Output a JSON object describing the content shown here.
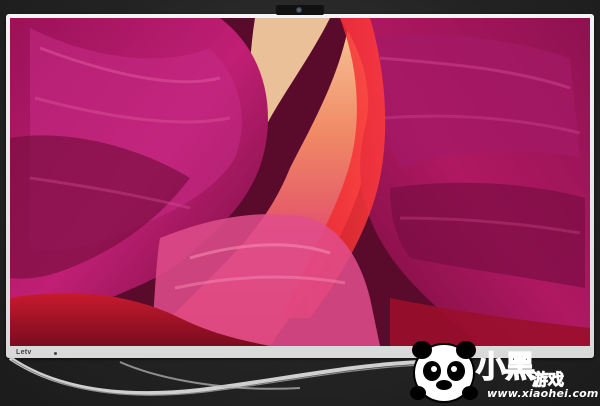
{
  "tv": {
    "brand": "Letv",
    "colors": {
      "bezel": "#e8e8e8",
      "background": "#2a2a2a"
    }
  },
  "screen_image": {
    "subject": "canyon-rock-waves",
    "colors": {
      "magenta": "#b0186a",
      "red": "#d0202c",
      "peach": "#f0a070",
      "dark": "#5c0c2d"
    }
  },
  "watermark": {
    "title": "小黑",
    "subtitle": "游戏",
    "url": "www.xiaohei.com",
    "mascot": "panda-icon",
    "colors": {
      "text": "#1ec0f2",
      "outline": "#ffffff"
    }
  }
}
